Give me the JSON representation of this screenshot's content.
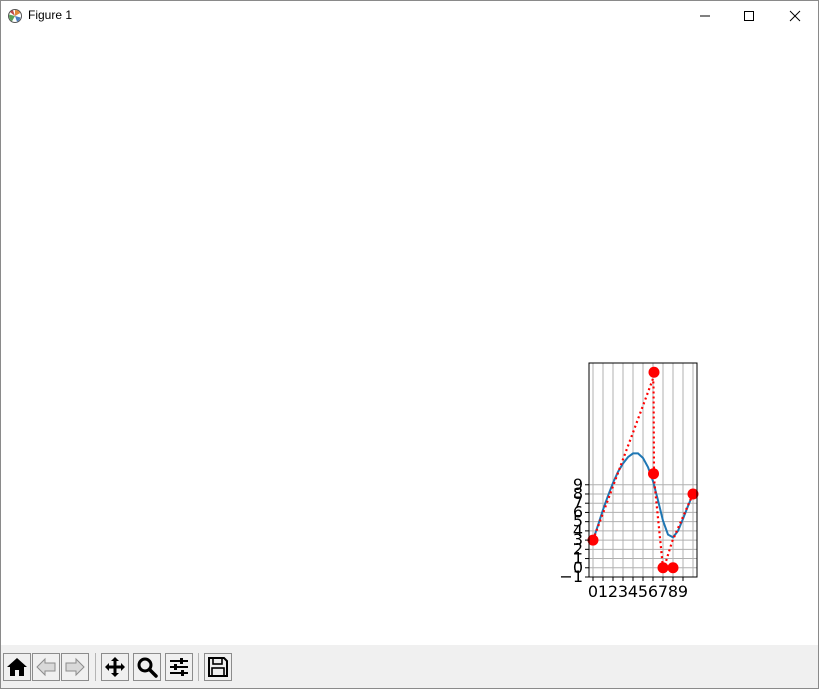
{
  "window": {
    "title": "Figure 1"
  },
  "icons": {
    "app": "matplotlib-icon",
    "minimize": "minimize-icon",
    "maximize": "maximize-icon",
    "close": "close-icon"
  },
  "toolbar": {
    "buttons": [
      {
        "name": "home-button",
        "icon": "home-icon"
      },
      {
        "name": "back-button",
        "icon": "back-arrow-icon"
      },
      {
        "name": "forward-button",
        "icon": "forward-arrow-icon"
      },
      {
        "name": "pan-button",
        "icon": "move-icon"
      },
      {
        "name": "zoom-button",
        "icon": "magnifier-icon"
      },
      {
        "name": "configure-subplots-button",
        "icon": "sliders-icon"
      },
      {
        "name": "save-button",
        "icon": "floppy-disk-icon"
      }
    ]
  },
  "colors": {
    "curve": "#1f77b4",
    "markers": "#ff0000",
    "dotted_line": "#ff0000",
    "grid": "#b0b0b0",
    "toolbar_bg": "#f0f0f0"
  },
  "chart_data": {
    "type": "line",
    "title": "",
    "xlabel": "",
    "ylabel": "",
    "grid": true,
    "xlim": [
      -0.4,
      10.4
    ],
    "ylim": [
      -1,
      22.2
    ],
    "xticks": [
      0,
      1,
      2,
      3,
      4,
      5,
      6,
      7,
      8,
      9
    ],
    "yticks": [
      -1,
      0,
      1,
      2,
      3,
      4,
      5,
      6,
      7,
      8,
      9
    ],
    "xgrid_lines": [
      0,
      1,
      2,
      3,
      4,
      5,
      6,
      7,
      8,
      9,
      10
    ],
    "ygrid_lines": [
      -1,
      0,
      1,
      2,
      3,
      4,
      5,
      6,
      7,
      8,
      9
    ],
    "series": [
      {
        "style": "solid",
        "x": [
          0,
          0.5,
          1,
          1.5,
          2,
          2.5,
          3,
          3.5,
          4,
          4.5,
          5,
          5.5,
          6,
          6.5,
          7,
          7.5,
          8,
          8.5,
          9,
          9.5,
          10
        ],
        "y": [
          3.0,
          4.6,
          6.3,
          7.8,
          9.2,
          10.4,
          11.3,
          12.0,
          12.4,
          12.4,
          11.9,
          10.9,
          9.4,
          7.3,
          5.1,
          3.6,
          3.3,
          4.0,
          5.3,
          6.7,
          8.0
        ]
      },
      {
        "style": "dotted",
        "x": [
          0,
          6,
          6.05,
          6.1,
          7,
          7.1,
          7.9,
          10
        ],
        "y": [
          3.0,
          20.5,
          19.8,
          9.7,
          0.0,
          0.0,
          2.8,
          8.0
        ]
      }
    ],
    "markers": {
      "x": [
        0,
        6.1,
        6.05,
        7,
        8,
        10
      ],
      "y": [
        3.0,
        21.2,
        10.2,
        0.0,
        0.0,
        8.0
      ]
    }
  }
}
